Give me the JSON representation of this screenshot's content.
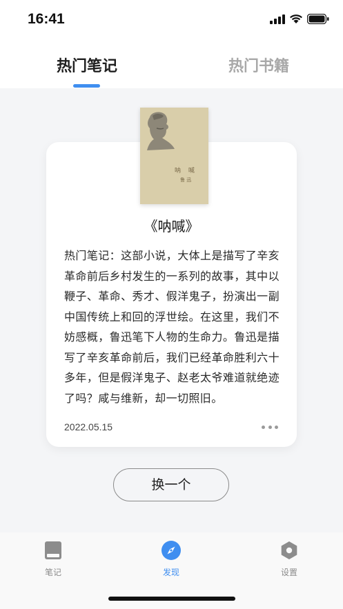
{
  "status_bar": {
    "time": "16:41"
  },
  "header": {
    "tabs": [
      {
        "label": "热门笔记",
        "active": true
      },
      {
        "label": "热门书籍",
        "active": false
      }
    ]
  },
  "book": {
    "cover_title": "呐 喊",
    "cover_author": "鲁 迅",
    "title": "《呐喊》"
  },
  "note": {
    "text": "热门笔记：这部小说，大体上是描写了辛亥革命前后乡村发生的一系列的故事，其中以鞭子、革命、秀才、假洋鬼子，扮演出一副中国传统上和回的浮世绘。在这里，我们不妨感概，鲁迅笔下人物的生命力。鲁迅是描写了辛亥革命前后，我们已经革命胜利六十多年，但是假洋鬼子、赵老太爷难道就绝迹了吗？咸与维新，却一切照旧。",
    "date": "2022.05.15"
  },
  "actions": {
    "swap_label": "换一个"
  },
  "tab_bar": {
    "items": [
      {
        "label": "笔记",
        "icon": "book-icon",
        "active": false
      },
      {
        "label": "发现",
        "icon": "compass-icon",
        "active": true
      },
      {
        "label": "设置",
        "icon": "hexagon-settings-icon",
        "active": false
      }
    ]
  },
  "colors": {
    "accent": "#3f8ef0",
    "inactive": "#8c8c8c",
    "background": "#f4f5f7"
  }
}
